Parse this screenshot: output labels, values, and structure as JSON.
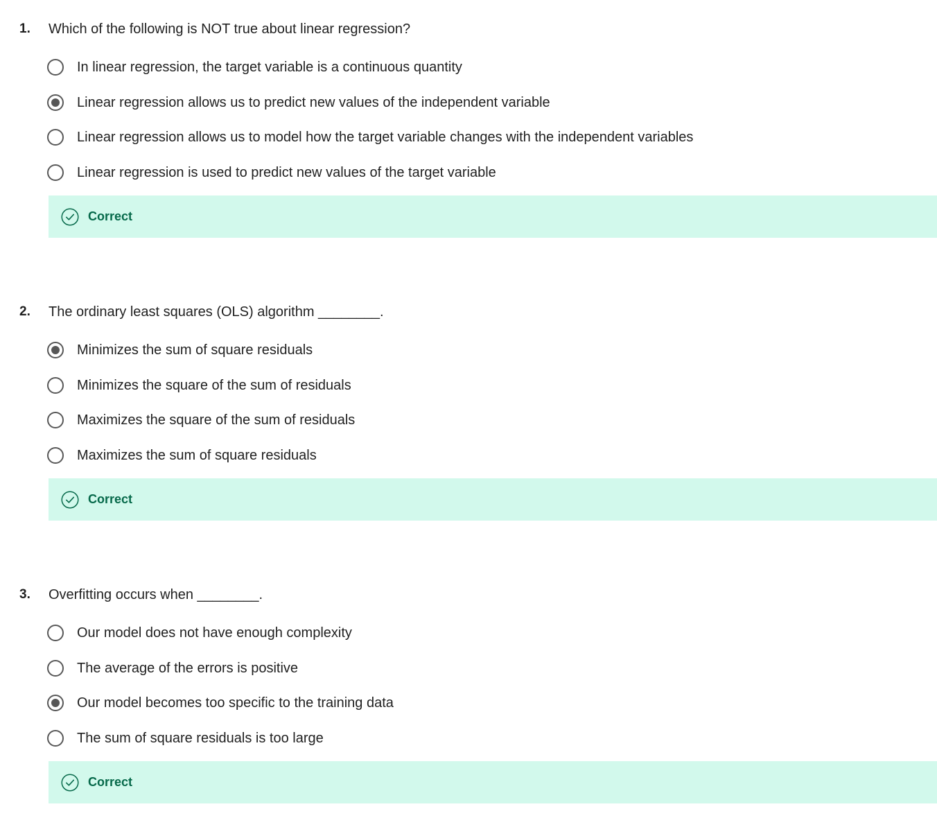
{
  "quiz": {
    "questions": [
      {
        "number": "1.",
        "text": "Which of the following is NOT true about linear regression?",
        "options": [
          {
            "label": "In linear regression, the target variable is a continuous quantity",
            "selected": false
          },
          {
            "label": "Linear regression allows us to predict new values of the independent variable",
            "selected": true
          },
          {
            "label": "Linear regression allows us to model how the target variable changes with the independent variables",
            "selected": false
          },
          {
            "label": "Linear regression is used to predict new values of the target variable",
            "selected": false
          }
        ],
        "feedback": "Correct"
      },
      {
        "number": "2.",
        "text": "The ordinary least squares (OLS) algorithm ________.",
        "options": [
          {
            "label": "Minimizes the sum of square residuals",
            "selected": true
          },
          {
            "label": "Minimizes the square of the sum of residuals",
            "selected": false
          },
          {
            "label": "Maximizes the square of the sum of residuals",
            "selected": false
          },
          {
            "label": "Maximizes the sum of square residuals",
            "selected": false
          }
        ],
        "feedback": "Correct"
      },
      {
        "number": "3.",
        "text": "Overfitting occurs when ________.",
        "options": [
          {
            "label": "Our model does not have enough complexity",
            "selected": false
          },
          {
            "label": "The average of the errors is positive",
            "selected": false
          },
          {
            "label": "Our model becomes too specific to the training data",
            "selected": true
          },
          {
            "label": "The sum of square residuals is too large",
            "selected": false
          }
        ],
        "feedback": "Correct"
      }
    ]
  },
  "colors": {
    "feedback_background": "#d2f9ec",
    "feedback_text": "#06694a",
    "radio_border": "#575757"
  },
  "icons": {
    "feedback": "check-circle-icon"
  }
}
